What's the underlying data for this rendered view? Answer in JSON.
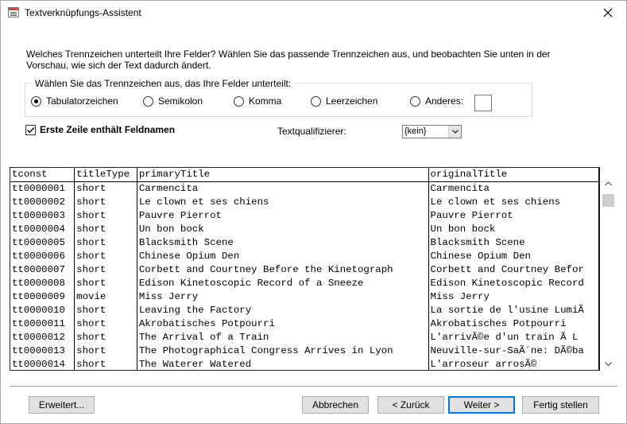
{
  "window": {
    "title": "Textverknüpfungs-Assistent",
    "close_glyph": "✕"
  },
  "intro_text": "Welches Trennzeichen unterteilt Ihre Felder? Wählen Sie das passende Trennzeichen aus, und beobachten Sie unten in der Vorschau, wie sich der Text dadurch ändert.",
  "delimiter_group": {
    "legend": "Wählen Sie das Trennzeichen aus, das Ihre Felder unterteilt:",
    "options": [
      {
        "label": "Tabulatorzeichen",
        "checked": true
      },
      {
        "label": "Semikolon",
        "checked": false
      },
      {
        "label": "Komma",
        "checked": false
      },
      {
        "label": "Leerzeichen",
        "checked": false
      },
      {
        "label": "Anderes:",
        "checked": false
      }
    ],
    "other_value": ""
  },
  "first_row_checkbox": {
    "label": "Erste Zeile enthält Feldnamen",
    "checked": true
  },
  "text_qualifier": {
    "label": "Textqualifizierer:",
    "value": "{kein}"
  },
  "preview": {
    "headers": [
      "tconst",
      "titleType",
      "primaryTitle",
      "originalTitle"
    ],
    "rows": [
      [
        "tt0000001",
        "short",
        "Carmencita",
        "Carmencita"
      ],
      [
        "tt0000002",
        "short",
        "Le clown et ses chiens",
        "Le clown et ses chiens"
      ],
      [
        "tt0000003",
        "short",
        "Pauvre Pierrot",
        "Pauvre Pierrot"
      ],
      [
        "tt0000004",
        "short",
        "Un bon bock",
        "Un bon bock"
      ],
      [
        "tt0000005",
        "short",
        "Blacksmith Scene",
        "Blacksmith Scene"
      ],
      [
        "tt0000006",
        "short",
        "Chinese Opium Den",
        "Chinese Opium Den"
      ],
      [
        "tt0000007",
        "short",
        "Corbett and Courtney Before the Kinetograph",
        "Corbett and Courtney Befor"
      ],
      [
        "tt0000008",
        "short",
        "Edison Kinetoscopic Record of a Sneeze",
        "Edison Kinetoscopic Record"
      ],
      [
        "tt0000009",
        "movie",
        "Miss Jerry",
        "Miss Jerry"
      ],
      [
        "tt0000010",
        "short",
        "Leaving the Factory",
        "La sortie de l'usine LumiÃ"
      ],
      [
        "tt0000011",
        "short",
        "Akrobatisches Potpourri",
        "Akrobatisches Potpourri"
      ],
      [
        "tt0000012",
        "short",
        "The Arrival of a Train",
        "L'arrivÃ©e d'un train Ã  L"
      ],
      [
        "tt0000013",
        "short",
        "The Photographical Congress Arrives in Lyon",
        "Neuville-sur-SaÃ´ne: DÃ©ba"
      ],
      [
        "tt0000014",
        "short",
        "The Waterer Watered",
        "L'arroseur arrosÃ©"
      ]
    ]
  },
  "buttons": {
    "advanced": "Erweitert...",
    "cancel": "Abbrechen",
    "back": "< Zurück",
    "next": "Weiter >",
    "finish": "Fertig stellen"
  }
}
